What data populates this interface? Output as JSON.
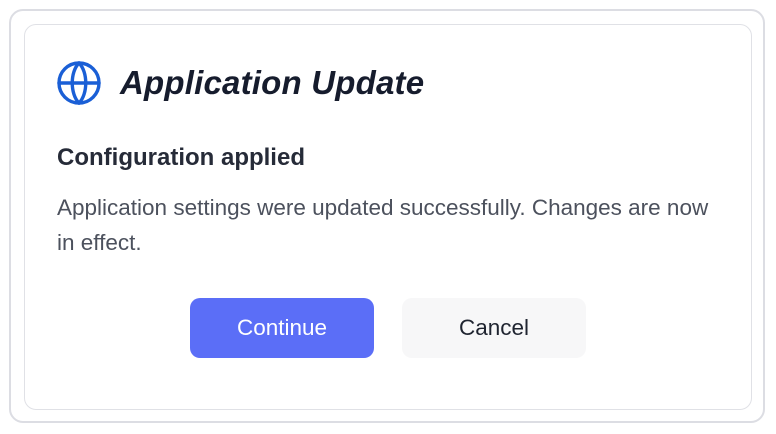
{
  "dialog": {
    "title": "Application Update",
    "icon": "globe-icon",
    "subtitle": "Configuration applied",
    "message": "Application settings were updated successfully. Changes are now in effect.",
    "accent_color": "#5b6ef7",
    "icon_color": "#1a5fd6"
  },
  "actions": {
    "continue_label": "Continue",
    "cancel_label": "Cancel"
  }
}
